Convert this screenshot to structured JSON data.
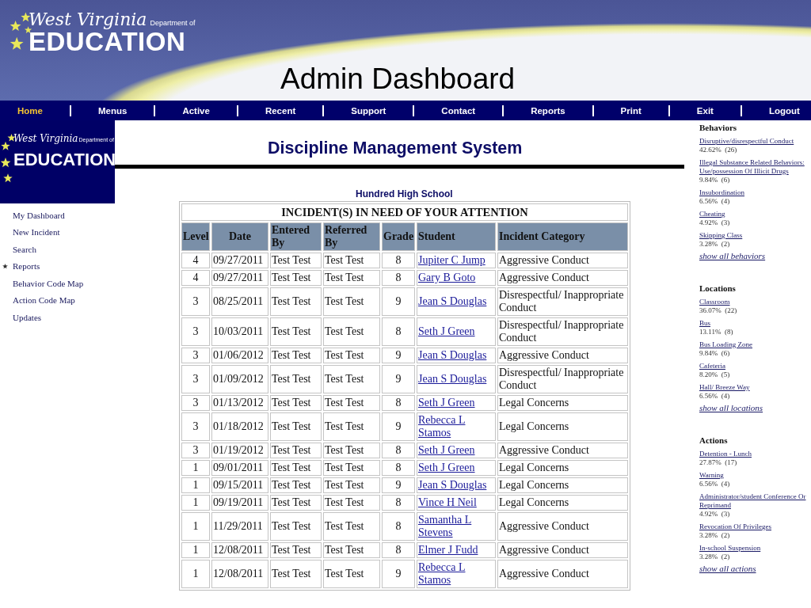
{
  "slide_title": "Admin Dashboard",
  "banner_logo": {
    "script": "West Virginia",
    "department": "Department of",
    "word": "EDUCATION"
  },
  "nav": [
    {
      "label": "Home",
      "selected": true
    },
    {
      "label": "Menus",
      "selected": false
    },
    {
      "label": "Active",
      "selected": false
    },
    {
      "label": "Recent",
      "selected": false
    },
    {
      "label": "Support",
      "selected": false
    },
    {
      "label": "Contact",
      "selected": false
    },
    {
      "label": "Reports",
      "selected": false
    },
    {
      "label": "Print",
      "selected": false
    },
    {
      "label": "Exit",
      "selected": false
    },
    {
      "label": "Logout",
      "selected": false
    }
  ],
  "sidebar": {
    "logo": {
      "script": "West Virginia",
      "department": "Department of",
      "word": "EDUCATION"
    },
    "items": [
      {
        "label": "My Dashboard",
        "expandable": false
      },
      {
        "label": "New Incident",
        "expandable": false
      },
      {
        "label": "Search",
        "expandable": false
      },
      {
        "label": "Reports",
        "expandable": true
      },
      {
        "label": "Behavior Code Map",
        "expandable": false
      },
      {
        "label": "Action Code Map",
        "expandable": false
      },
      {
        "label": "Updates",
        "expandable": false
      }
    ]
  },
  "page_title": "Discipline Management System",
  "school": "Hundred High School",
  "table": {
    "caption": "INCIDENT(S) IN NEED OF YOUR ATTENTION",
    "columns": [
      "Level",
      "Date",
      "Entered By",
      "Referred By",
      "Grade",
      "Student",
      "Incident Category"
    ],
    "rows": [
      [
        "4",
        "09/27/2011",
        "Test Test",
        "Test Test",
        "8",
        "Jupiter C Jump",
        "Aggressive Conduct"
      ],
      [
        "4",
        "09/27/2011",
        "Test Test",
        "Test Test",
        "8",
        "Gary B Goto",
        "Aggressive Conduct"
      ],
      [
        "3",
        "08/25/2011",
        "Test Test",
        "Test Test",
        "9",
        "Jean S Douglas",
        "Disrespectful/ Inappropriate Conduct"
      ],
      [
        "3",
        "10/03/2011",
        "Test Test",
        "Test Test",
        "8",
        "Seth J Green",
        "Disrespectful/ Inappropriate Conduct"
      ],
      [
        "3",
        "01/06/2012",
        "Test Test",
        "Test Test",
        "9",
        "Jean S Douglas",
        "Aggressive Conduct"
      ],
      [
        "3",
        "01/09/2012",
        "Test Test",
        "Test Test",
        "9",
        "Jean S Douglas",
        "Disrespectful/ Inappropriate Conduct"
      ],
      [
        "3",
        "01/13/2012",
        "Test Test",
        "Test Test",
        "8",
        "Seth J Green",
        "Legal Concerns"
      ],
      [
        "3",
        "01/18/2012",
        "Test Test",
        "Test Test",
        "9",
        "Rebecca L Stamos",
        "Legal Concerns"
      ],
      [
        "3",
        "01/19/2012",
        "Test Test",
        "Test Test",
        "8",
        "Seth J Green",
        "Aggressive Conduct"
      ],
      [
        "1",
        "09/01/2011",
        "Test Test",
        "Test Test",
        "8",
        "Seth J Green",
        "Legal Concerns"
      ],
      [
        "1",
        "09/15/2011",
        "Test Test",
        "Test Test",
        "9",
        "Jean S Douglas",
        "Legal Concerns"
      ],
      [
        "1",
        "09/19/2011",
        "Test Test",
        "Test Test",
        "8",
        "Vince H Neil",
        "Legal Concerns"
      ],
      [
        "1",
        "11/29/2011",
        "Test Test",
        "Test Test",
        "8",
        "Samantha L Stevens",
        "Aggressive Conduct"
      ],
      [
        "1",
        "12/08/2011",
        "Test Test",
        "Test Test",
        "8",
        "Elmer J Fudd",
        "Aggressive Conduct"
      ],
      [
        "1",
        "12/08/2011",
        "Test Test",
        "Test Test",
        "9",
        "Rebecca L Stamos",
        "Aggressive Conduct"
      ]
    ]
  },
  "stats": [
    {
      "heading": "Behaviors",
      "items": [
        {
          "label": "Disruptive/disrespectful Conduct",
          "value": "42.62%  (26)"
        },
        {
          "label": "Illegal Substance Related Behaviors: Use/possession Of Illicit Drugs",
          "value": "9.84%  (6)"
        },
        {
          "label": "Insubordination",
          "value": "6.56%  (4)"
        },
        {
          "label": "Cheating",
          "value": "4.92%  (3)"
        },
        {
          "label": "Skipping Class",
          "value": "3.28%  (2)"
        }
      ],
      "more": "show all behaviors"
    },
    {
      "heading": "Locations",
      "items": [
        {
          "label": "Classroom",
          "value": "36.07%  (22)"
        },
        {
          "label": "Bus",
          "value": "13.11%  (8)"
        },
        {
          "label": "Bus Loading Zone",
          "value": "9.84%  (6)"
        },
        {
          "label": "Cafeteria",
          "value": "8.20%  (5)"
        },
        {
          "label": "Hall/ Breeze Way",
          "value": "6.56%  (4)"
        }
      ],
      "more": "show all locations"
    },
    {
      "heading": "Actions",
      "items": [
        {
          "label": "Detention - Lunch",
          "value": "27.87%  (17)"
        },
        {
          "label": "Warning",
          "value": "6.56%  (4)"
        },
        {
          "label": "Administrator/student Conference Or Reprimand",
          "value": "4.92%  (3)"
        },
        {
          "label": "Revocation Of Privileges",
          "value": "3.28%  (2)"
        },
        {
          "label": "In-school Suspension",
          "value": "3.28%  (2)"
        }
      ],
      "more": "show all actions"
    }
  ]
}
